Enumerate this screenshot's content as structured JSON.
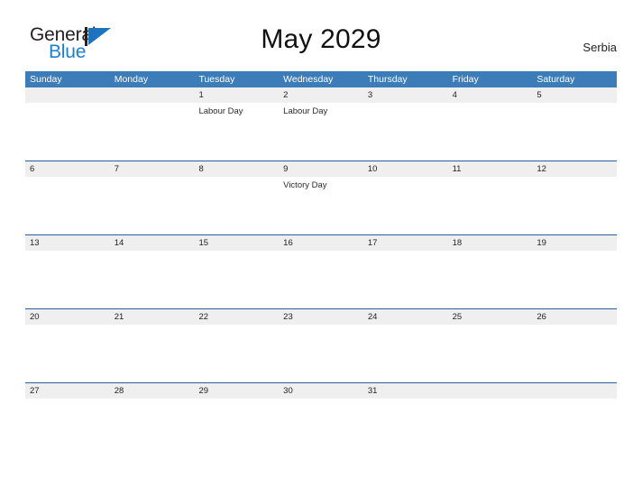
{
  "brand": {
    "word_general": "General",
    "word_blue": "Blue",
    "logo_icon": "triangle-flag-icon"
  },
  "header": {
    "title": "May 2029",
    "country": "Serbia"
  },
  "calendar": {
    "weekdays": [
      "Sunday",
      "Monday",
      "Tuesday",
      "Wednesday",
      "Thursday",
      "Friday",
      "Saturday"
    ],
    "colors": {
      "header_blue": "#3b7cb9",
      "row_band_gray": "#efefef",
      "row_rule_blue": "#2a6099",
      "brand_blue": "#1d7fd0",
      "text_dark": "#231f20"
    },
    "weeks": [
      [
        {
          "day": "",
          "events": []
        },
        {
          "day": "",
          "events": []
        },
        {
          "day": "1",
          "events": [
            "Labour Day"
          ]
        },
        {
          "day": "2",
          "events": [
            "Labour Day"
          ]
        },
        {
          "day": "3",
          "events": []
        },
        {
          "day": "4",
          "events": []
        },
        {
          "day": "5",
          "events": []
        }
      ],
      [
        {
          "day": "6",
          "events": []
        },
        {
          "day": "7",
          "events": []
        },
        {
          "day": "8",
          "events": []
        },
        {
          "day": "9",
          "events": [
            "Victory Day"
          ]
        },
        {
          "day": "10",
          "events": []
        },
        {
          "day": "11",
          "events": []
        },
        {
          "day": "12",
          "events": []
        }
      ],
      [
        {
          "day": "13",
          "events": []
        },
        {
          "day": "14",
          "events": []
        },
        {
          "day": "15",
          "events": []
        },
        {
          "day": "16",
          "events": []
        },
        {
          "day": "17",
          "events": []
        },
        {
          "day": "18",
          "events": []
        },
        {
          "day": "19",
          "events": []
        }
      ],
      [
        {
          "day": "20",
          "events": []
        },
        {
          "day": "21",
          "events": []
        },
        {
          "day": "22",
          "events": []
        },
        {
          "day": "23",
          "events": []
        },
        {
          "day": "24",
          "events": []
        },
        {
          "day": "25",
          "events": []
        },
        {
          "day": "26",
          "events": []
        }
      ],
      [
        {
          "day": "27",
          "events": []
        },
        {
          "day": "28",
          "events": []
        },
        {
          "day": "29",
          "events": []
        },
        {
          "day": "30",
          "events": []
        },
        {
          "day": "31",
          "events": []
        },
        {
          "day": "",
          "events": []
        },
        {
          "day": "",
          "events": []
        }
      ]
    ]
  }
}
